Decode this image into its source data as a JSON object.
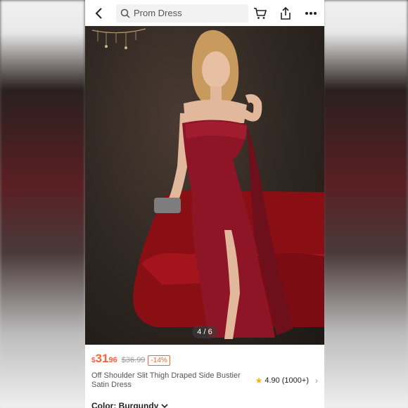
{
  "search": {
    "placeholder": "Prom Dress"
  },
  "icons": {
    "back": "chevron-left-icon",
    "search": "search-icon",
    "cart": "cart-icon",
    "share": "share-icon",
    "more": "more-icon"
  },
  "gallery": {
    "counter": "4 / 6"
  },
  "product": {
    "currency": "$",
    "price_int": "31",
    "price_dec": ".96",
    "original_price": "$36.99",
    "discount": "-14%",
    "title": "Off Shoulder Slit Thigh Draped Side Bustier Satin Dress",
    "rating": "4.90",
    "reviews": "(1000+)",
    "color_label": "Color: Burgundy"
  },
  "colors": {
    "accent": "#fa6338",
    "star": "#f7b500",
    "dress": "#8e1526"
  }
}
